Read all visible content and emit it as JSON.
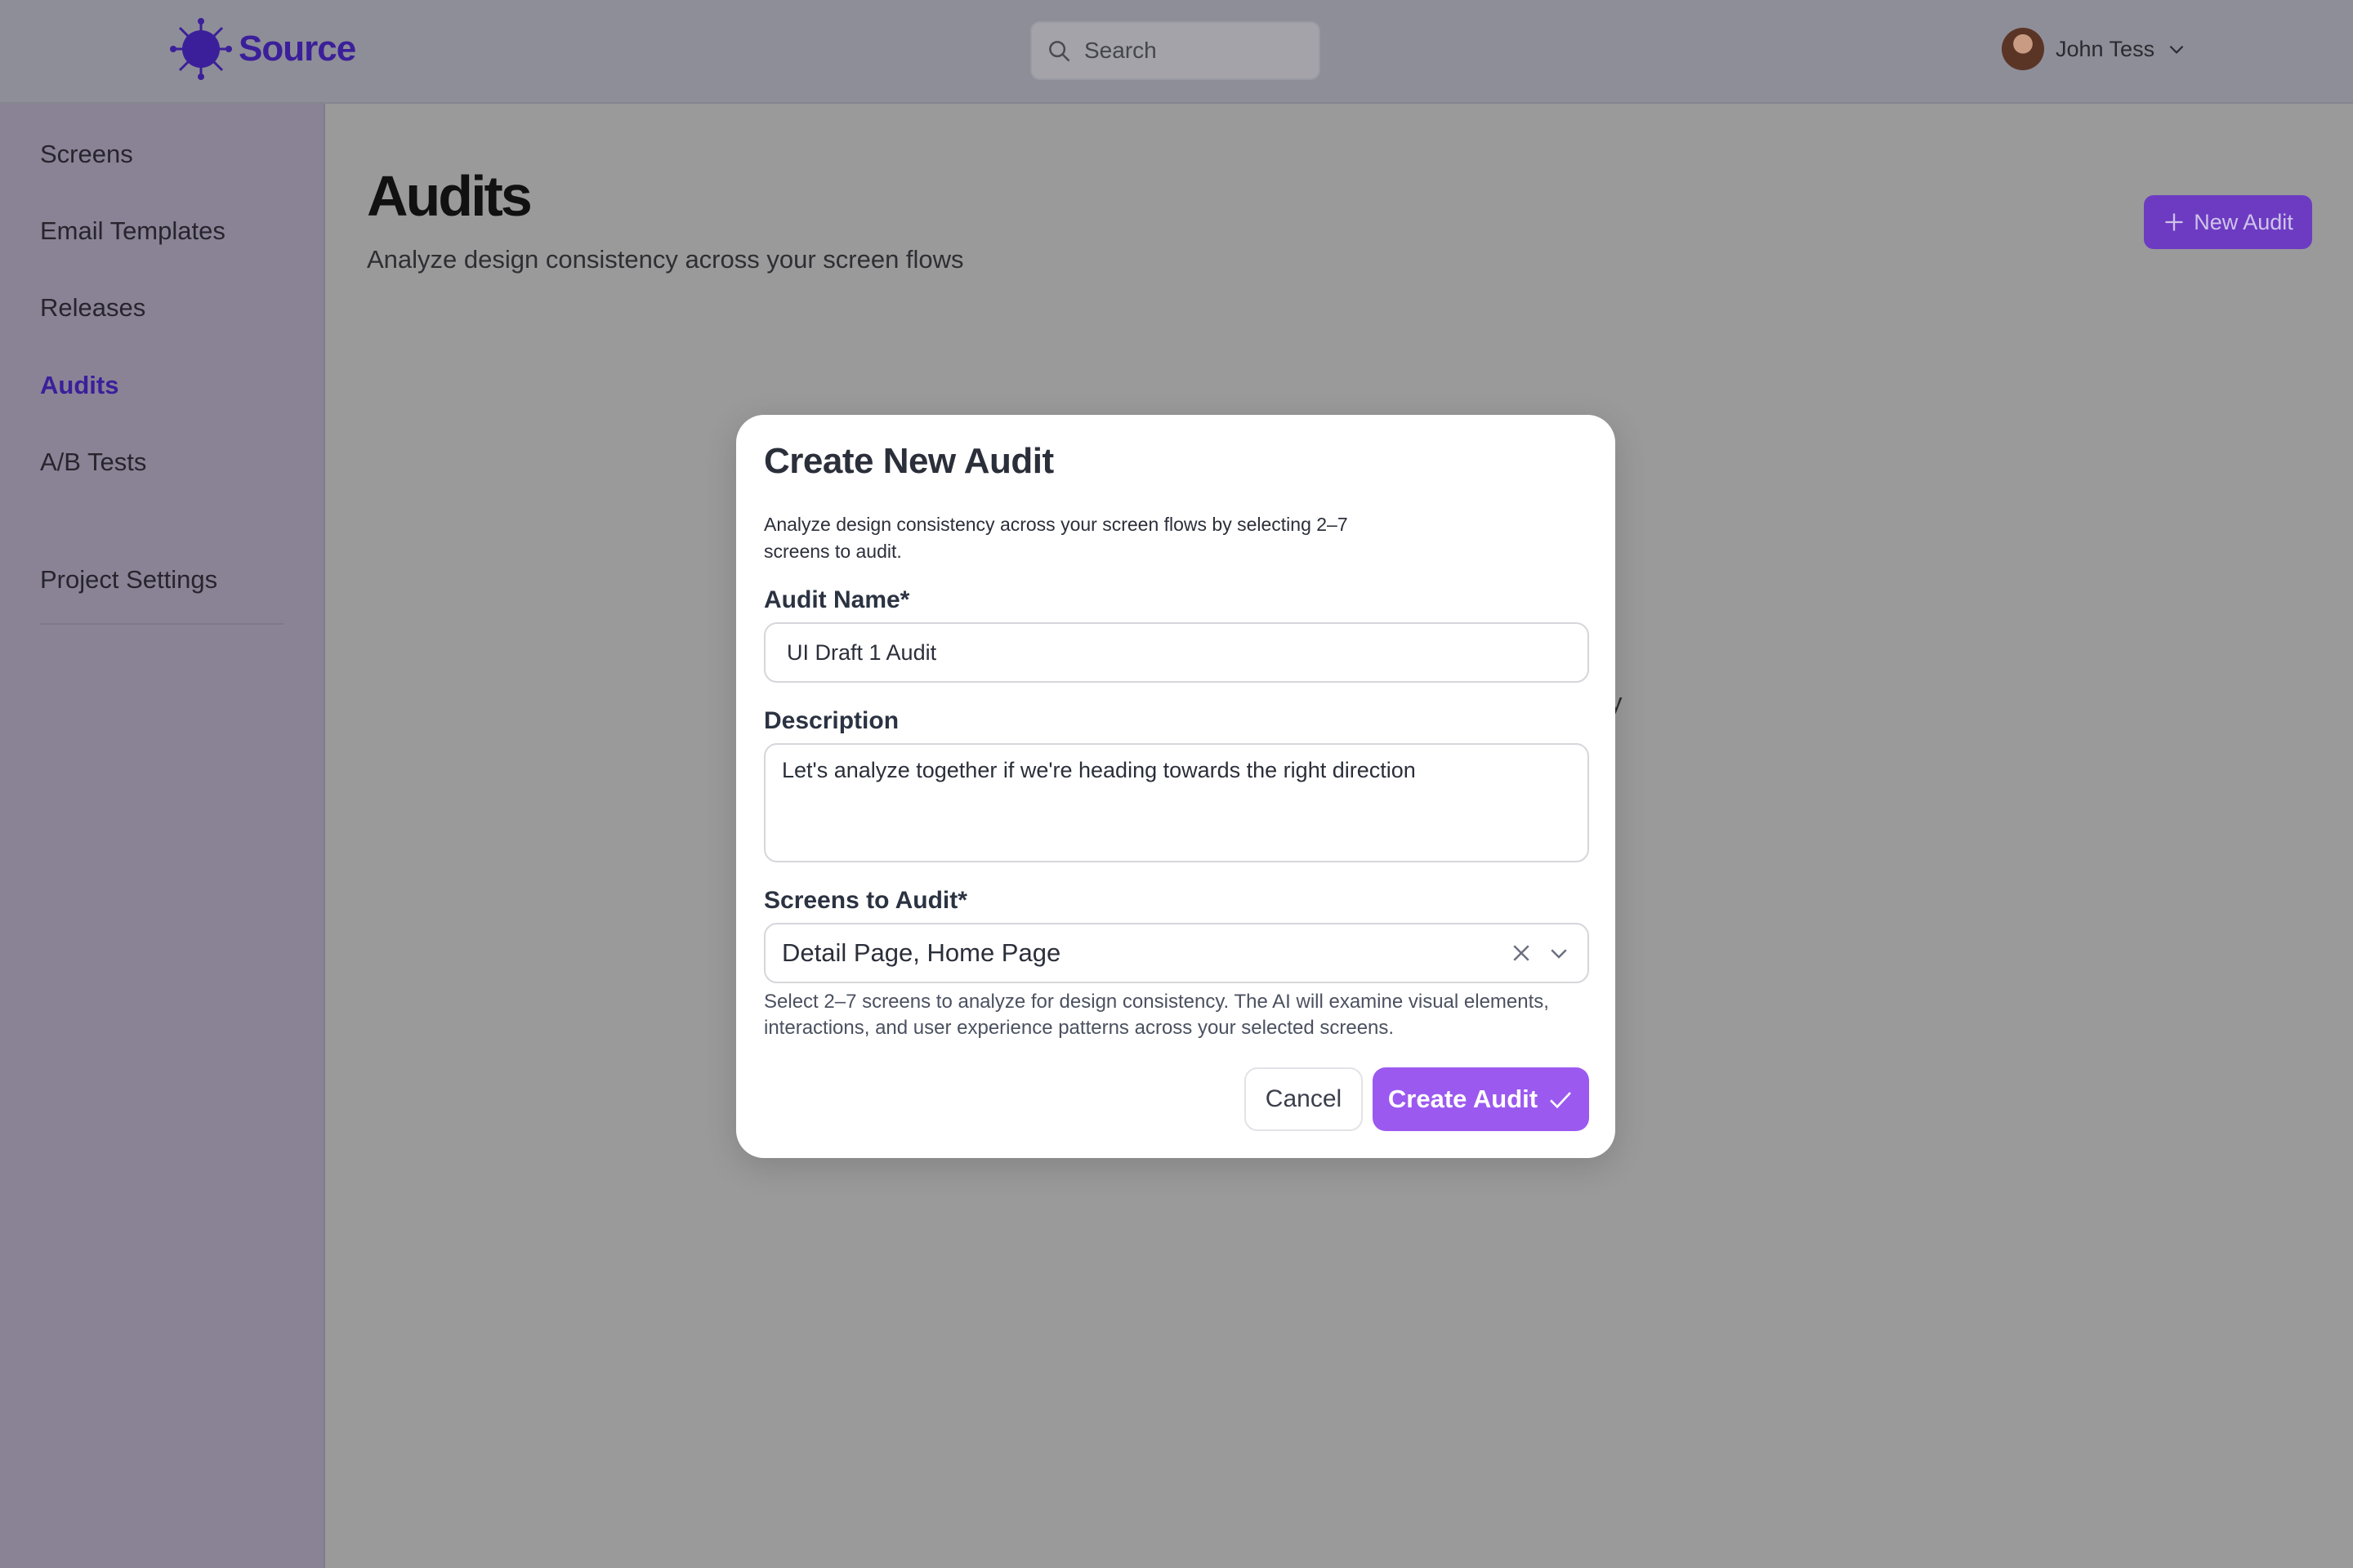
{
  "brand": {
    "name": "Source",
    "accent": "#3b1f9a"
  },
  "header": {
    "search_placeholder": "Search",
    "user_name": "John Tess"
  },
  "sidebar": {
    "items": [
      {
        "label": "Screens"
      },
      {
        "label": "Email Templates"
      },
      {
        "label": "Releases"
      },
      {
        "label": "Audits",
        "active": true
      },
      {
        "label": "A/B Tests"
      }
    ],
    "footer_item": {
      "label": "Project Settings"
    }
  },
  "page": {
    "title": "Audits",
    "subtitle": "Analyze design consistency across your screen flows",
    "new_button": "New Audit",
    "obscured_text": "y"
  },
  "modal": {
    "title": "Create New Audit",
    "description": "Analyze design consistency across your screen flows by selecting 2–7 screens to audit.",
    "name_label": "Audit Name*",
    "name_value": "UI Draft 1 Audit",
    "desc_label": "Description",
    "desc_value": "Let's analyze together if we're heading towards the right direction",
    "screens_label": "Screens to Audit*",
    "screens_value": "Detail Page, Home Page",
    "helper": "Select 2–7 screens to analyze for design consistency. The AI will examine visual elements, interactions, and user experience patterns across your selected screens.",
    "cancel_label": "Cancel",
    "create_label": "Create Audit",
    "primary_color": "#9b59f0"
  }
}
